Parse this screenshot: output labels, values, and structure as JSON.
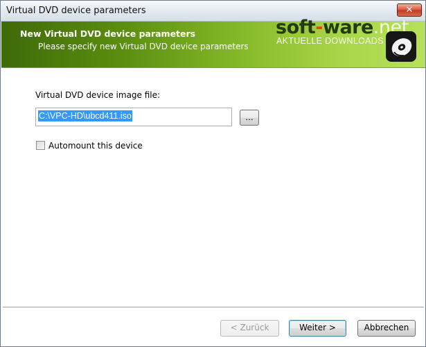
{
  "window": {
    "title": "Virtual DVD device parameters",
    "close_label": "✕"
  },
  "banner": {
    "title": "New Virtual DVD device parameters",
    "subtitle": "Please specify new Virtual DVD device parameters",
    "background_color": "#88bb2a"
  },
  "watermark": {
    "brand_part1": "soft",
    "brand_dash": "-",
    "brand_part2": "ware",
    "brand_net": ".net",
    "tagline": "AKTUELLE DOWNLOADS",
    "icon": "dvd-disc-icon"
  },
  "form": {
    "image_file_label": "Virtual DVD device image file:",
    "image_file_value": "C:\\VPC-HD\\ubcd411.iso",
    "browse_label": "...",
    "automount_label": "Automount this device",
    "automount_checked": false
  },
  "footer": {
    "back_label": "< Zurück",
    "next_label": "Weiter >",
    "cancel_label": "Abbrechen"
  },
  "colors": {
    "selection": "#3399ff",
    "close_button": "#d8543a"
  }
}
